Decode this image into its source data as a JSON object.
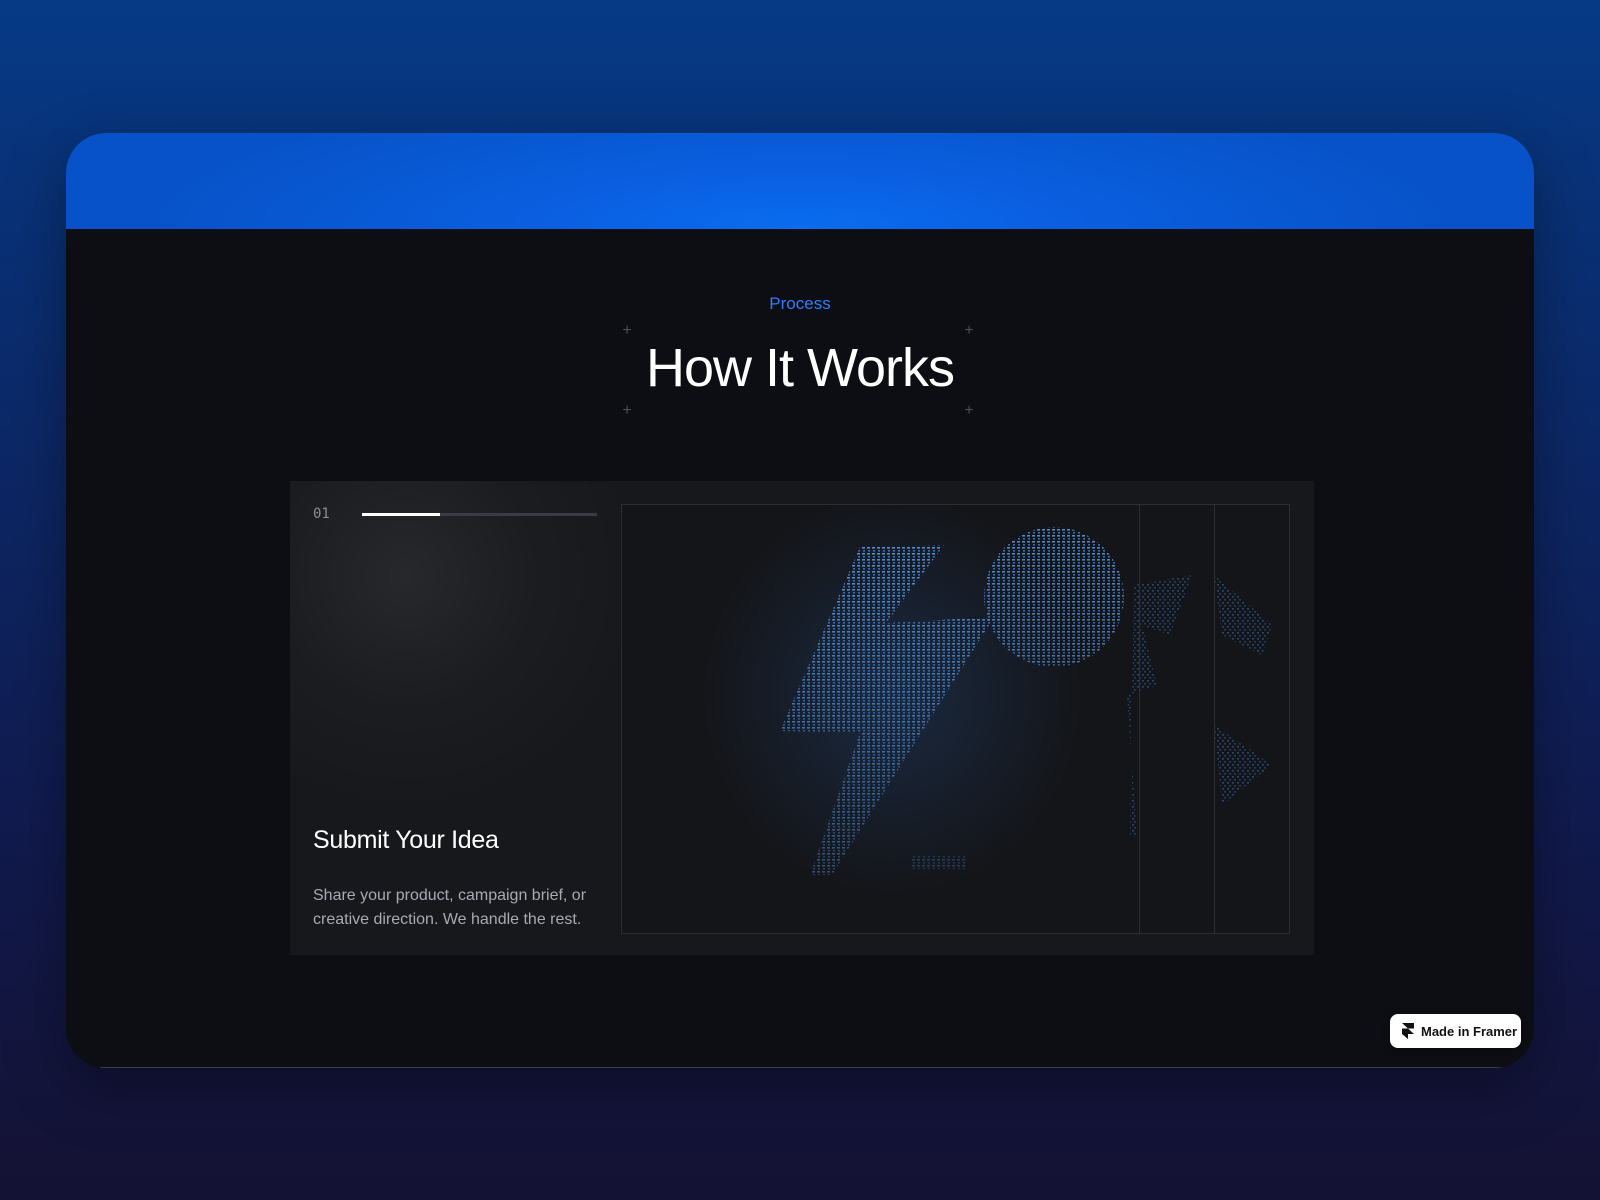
{
  "section": {
    "eyebrow": "Process",
    "title": "How It Works"
  },
  "step": {
    "number": "01",
    "progress": 0.33,
    "title": "Submit Your Idea",
    "description": "Share your product, campaign brief, or creative direction. We handle the rest."
  },
  "visual": {
    "icon": "lightning-bolt-ascii-icon",
    "glyph_color": "#4a90e2"
  },
  "badge": {
    "label": "Made in Framer",
    "icon": "framer-logo-icon"
  },
  "colors": {
    "accent": "#2f7dff",
    "band": "#0a6cf0",
    "background": "#0d0e13"
  }
}
